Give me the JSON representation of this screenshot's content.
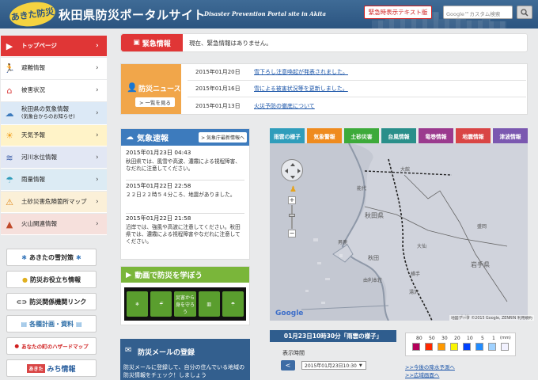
{
  "header": {
    "logo_text": "あきた防災",
    "title": "秋田県防災ポータルサイト",
    "subtitle": "Disaster Prevention Portal site in Akita",
    "text_mode_button": "緊急時表示テキスト版",
    "search_placeholder": "Google™カスタム検索"
  },
  "sidebar": {
    "items": [
      {
        "label": "トップページ",
        "icon": "home-icon",
        "bg": "#e03636"
      },
      {
        "label": "避難情報",
        "icon": "running-person-icon",
        "bg": "#ffffff"
      },
      {
        "label": "被害状況",
        "icon": "damaged-house-icon",
        "bg": "#ffffff"
      },
      {
        "label": "秋田県の気象情報",
        "sub": "(気象台からのお知らせ)",
        "icon": "cloud-icon",
        "bg": "#dce9f6"
      },
      {
        "label": "天気予報",
        "icon": "sun-icon",
        "bg": "#fff3c8"
      },
      {
        "label": "河川水位情報",
        "icon": "waves-icon",
        "bg": "#e2e7f4"
      },
      {
        "label": "雨量情報",
        "icon": "umbrella-icon",
        "bg": "#dcebf4"
      },
      {
        "label": "土砂災害危険箇所マップ",
        "icon": "warning-icon",
        "bg": "#fbf0d8"
      },
      {
        "label": "火山関連情報",
        "icon": "volcano-icon",
        "bg": "#f6e0dc"
      }
    ],
    "banners": [
      {
        "label": "あきたの雪対策",
        "icon": "snowflake-icon"
      },
      {
        "label": "防災お役立ち情報",
        "icon": "lightbulb-icon"
      },
      {
        "label": "防災関係機関リンク",
        "icon": "chain-link-icon"
      },
      {
        "label": "各種計画・資料",
        "icon": "books-icon"
      },
      {
        "label": "あなたの町のハザードマップ",
        "icon": "map-pin-icon"
      },
      {
        "label": "みち情報",
        "prefix": "あきた",
        "icon": "road-info-icon"
      }
    ]
  },
  "emergency": {
    "title": "緊急情報",
    "text": "現在、緊急情報はありません。"
  },
  "news": {
    "title": "防災ニュース",
    "more_button": "> 一覧を見る",
    "items": [
      {
        "date": "2015年01月20日",
        "text": "雪下ろし注意喚起が発表されました。"
      },
      {
        "date": "2015年01月16日",
        "text": "雪による被害状況等を更新しました。"
      },
      {
        "date": "2015年01月13日",
        "text": "火災予防の徹底について"
      }
    ]
  },
  "kisho": {
    "title": "気象速報",
    "link": "> 気象庁最新情報へ",
    "entries": [
      {
        "time": "2015年01月23日 04:43",
        "text": "秋田県では、風雪や高波、濃霧による視程障害、なだれに注意してください。"
      },
      {
        "time": "2015年01月22日 22:58",
        "text": "２２日２２時５４分ころ、地震がありました。"
      },
      {
        "time": "2015年01月22日 21:58",
        "text": "沿岸では、強風や高波に注意してください。秋田県では、濃霧による視程障害やなだれに注意してください。"
      }
    ]
  },
  "video": {
    "title": "動画で防災を学ぼう",
    "frames": [
      "",
      "",
      "災害から身を守ろう",
      "",
      ""
    ]
  },
  "mail": {
    "title": "防災メールの登録",
    "desc": "防災メールに登録して、自分の住んでいる地域の防災情報をチェック！しましょう"
  },
  "tabs": [
    {
      "label": "雨雲の様子",
      "color": "#2f9dbb"
    },
    {
      "label": "気象警報",
      "color": "#ef8b1e"
    },
    {
      "label": "土砂災害",
      "color": "#3daa3a"
    },
    {
      "label": "台風情報",
      "color": "#2a8f8a"
    },
    {
      "label": "竜巻情報",
      "color": "#9b3a8e"
    },
    {
      "label": "地震情報",
      "color": "#d94545"
    },
    {
      "label": "津波情報",
      "color": "#7b58b0"
    }
  ],
  "map": {
    "labels": [
      "秋田県",
      "大館",
      "能代",
      "秋田",
      "男鹿",
      "大仙",
      "横手",
      "湯沢",
      "由利本荘",
      "岩手県",
      "盛岡",
      "大崎"
    ],
    "google": "Google",
    "credit": "地図データ ©2015 Google, ZENRIN  利用規約"
  },
  "time_label": "01月23日10時30分「雨雲の様子」",
  "display_time_label": "表示時間",
  "prev_button": "<",
  "time_select": "2015年01月23日10:30",
  "legend": {
    "values": [
      "80",
      "50",
      "30",
      "20",
      "10",
      "5",
      "1",
      "(mm)"
    ],
    "colors": [
      "#b4005a",
      "#ff2800",
      "#ff9900",
      "#faf500",
      "#0041ff",
      "#218cff",
      "#a0d2ff",
      "#f2f2ff"
    ]
  },
  "links": {
    "forecast": ">>今後の降水予測へ",
    "wide": ">>広域画面へ"
  }
}
